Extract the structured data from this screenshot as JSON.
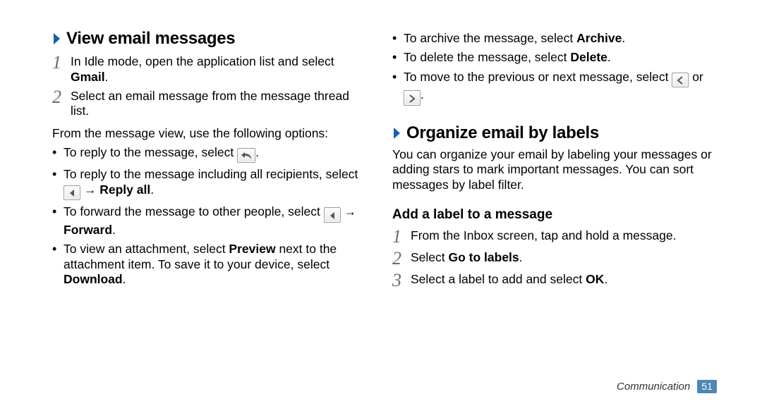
{
  "footer": {
    "chapter": "Communication",
    "page": "51"
  },
  "left": {
    "h1": "View email messages",
    "steps": [
      {
        "n": "1",
        "pre": "In Idle mode, open the application list and select ",
        "bold": "Gmail",
        "post": "."
      },
      {
        "n": "2",
        "pre": "Select an email message from the message thread list.",
        "bold": "",
        "post": ""
      }
    ],
    "lead": "From the message view, use the following options:",
    "bullets": {
      "reply": {
        "t1": "To reply to the message, select ",
        "t2": "."
      },
      "replyall": {
        "t1": "To reply to the message including all recipients, select ",
        "arrow": " → ",
        "bold": "Reply all",
        "t2": "."
      },
      "forward": {
        "t1": "To forward the message to other people, select ",
        "arrow": " → ",
        "bold": "Forward",
        "t2": "."
      },
      "attach": {
        "t1": "To view an attachment, select ",
        "b1": "Preview",
        "t2": " next to the attachment item. To save it to your device, select ",
        "b2": "Download",
        "t3": "."
      }
    }
  },
  "right": {
    "bullets": {
      "archive": {
        "t1": "To archive the message, select ",
        "b": "Archive",
        "t2": "."
      },
      "delete": {
        "t1": "To delete the message, select ",
        "b": "Delete",
        "t2": "."
      },
      "nav": {
        "t1": "To move to the previous or next message, select ",
        "or": " or ",
        "t2": "."
      }
    },
    "h1": "Organize email by labels",
    "intro": "You can organize your email by labeling your messages or adding stars to mark important messages. You can sort messages by label filter.",
    "h2": "Add a label to a message",
    "steps": [
      {
        "n": "1",
        "pre": "From the Inbox screen, tap and hold a message.",
        "bold": "",
        "post": ""
      },
      {
        "n": "2",
        "pre": "Select ",
        "bold": "Go to labels",
        "post": "."
      },
      {
        "n": "3",
        "pre": "Select a label to add and select ",
        "bold": "OK",
        "post": "."
      }
    ]
  }
}
